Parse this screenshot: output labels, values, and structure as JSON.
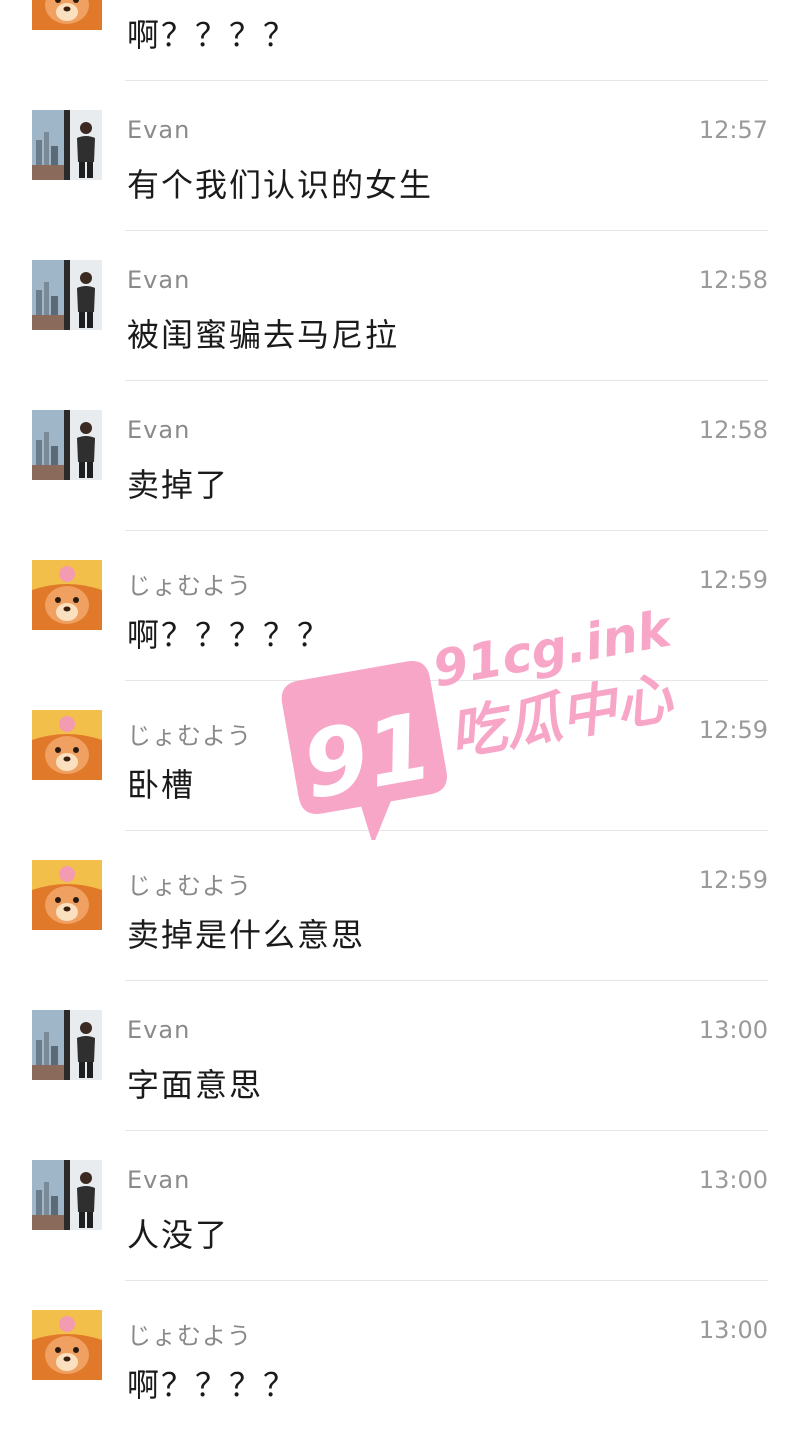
{
  "messages": [
    {
      "sender": "",
      "avatar": "cartoon-bear-avatar",
      "time": "",
      "text": "啊？？？？"
    },
    {
      "sender": "Evan",
      "avatar": "city-window-avatar",
      "time": "12:57",
      "text": "有个我们认识的女生"
    },
    {
      "sender": "Evan",
      "avatar": "city-window-avatar",
      "time": "12:58",
      "text": "被闺蜜骗去马尼拉"
    },
    {
      "sender": "Evan",
      "avatar": "city-window-avatar",
      "time": "12:58",
      "text": "卖掉了"
    },
    {
      "sender": "じょむよう",
      "avatar": "cartoon-bear-avatar",
      "time": "12:59",
      "text": "啊？？？？？"
    },
    {
      "sender": "じょむよう",
      "avatar": "cartoon-bear-avatar",
      "time": "12:59",
      "text": "卧槽"
    },
    {
      "sender": "じょむよう",
      "avatar": "cartoon-bear-avatar",
      "time": "12:59",
      "text": "卖掉是什么意思"
    },
    {
      "sender": "Evan",
      "avatar": "city-window-avatar",
      "time": "13:00",
      "text": "字面意思"
    },
    {
      "sender": "Evan",
      "avatar": "city-window-avatar",
      "time": "13:00",
      "text": "人没了"
    },
    {
      "sender": "じょむよう",
      "avatar": "cartoon-bear-avatar",
      "time": "13:00",
      "text": "啊？？？？"
    }
  ],
  "watermark": {
    "number": "91",
    "domain": "91cg.ink",
    "name": "吃瓜中心",
    "color": "#f7a6c8"
  }
}
